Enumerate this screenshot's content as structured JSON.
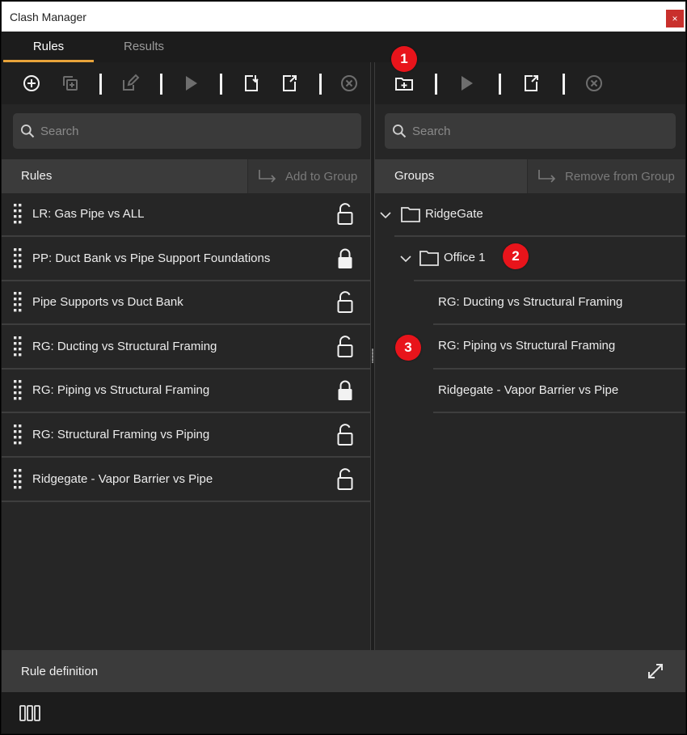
{
  "window": {
    "title": "Clash Manager",
    "close_label": "×"
  },
  "tabs": [
    {
      "label": "Rules",
      "active": true
    },
    {
      "label": "Results",
      "active": false
    }
  ],
  "left": {
    "search_placeholder": "Search",
    "section_label": "Rules",
    "action_label": "Add to Group",
    "rules": [
      {
        "name": "LR: Gas Pipe vs ALL",
        "locked": false
      },
      {
        "name": "PP: Duct Bank vs Pipe Support Foundations",
        "locked": true
      },
      {
        "name": "Pipe Supports vs Duct Bank",
        "locked": false
      },
      {
        "name": "RG: Ducting vs Structural Framing",
        "locked": false
      },
      {
        "name": "RG: Piping vs Structural Framing",
        "locked": true
      },
      {
        "name": "RG: Structural Framing vs Piping",
        "locked": false
      },
      {
        "name": "Ridgegate - Vapor Barrier vs Pipe",
        "locked": false
      }
    ]
  },
  "right": {
    "search_placeholder": "Search",
    "section_label": "Groups",
    "action_label": "Remove from Group",
    "tree": {
      "root": "RidgeGate",
      "subfolder": "Office 1",
      "items": [
        "RG: Ducting vs Structural Framing",
        "RG: Piping vs Structural Framing",
        "Ridgegate - Vapor Barrier vs Pipe"
      ]
    }
  },
  "callouts": [
    "1",
    "2",
    "3"
  ],
  "bottom": {
    "label": "Rule definition"
  },
  "colors": {
    "accent": "#e8a33a",
    "callout": "#e8141b",
    "close": "#c9302c"
  }
}
